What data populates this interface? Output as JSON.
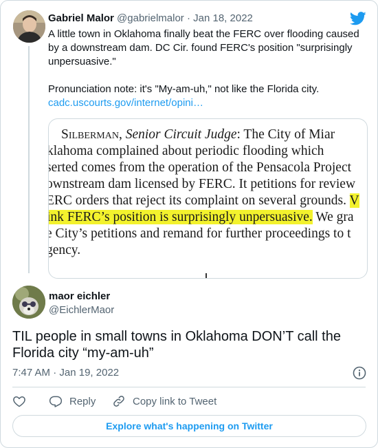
{
  "quoted_tweet": {
    "name": "Gabriel Malor",
    "handle": "@gabrielmalor",
    "separator": "·",
    "date": "Jan 18, 2022",
    "text_line1": "A little town in Oklahoma finally beat the FERC over flooding caused by a downstream dam. DC Cir. found FERC's position \"surprisingly unpersuasive.\"",
    "text_line2": "Pronunciation note: it's \"My-am-uh,\" not like the Florida city.",
    "link": "cadc.uscourts.gov/internet/opini…",
    "image_text": {
      "l1_smallcaps": "Silberman,",
      "l1_italic": "Senior Circuit Judge",
      "l1_rest": ": The City of Miar",
      "l2": "klahoma complained about periodic flooding which",
      "l3": "serted comes from the operation of the Pensacola Project",
      "l4": "ownstream dam licensed by FERC.  It petitions for review",
      "l5_a": "ERC orders that reject its complaint on several grounds.  ",
      "l5_b": "V",
      "l6_hl": "ink FERC’s position is surprisingly unpersuasive.",
      "l6_rest": "  We gra",
      "l7": "e City’s petitions and remand for further proceedings to t",
      "l8": "gency."
    }
  },
  "tweet": {
    "name": "maor eichler",
    "handle": "@EichlerMaor",
    "text": "TIL people in small towns in Oklahoma DON’T call the Florida city “my-am-uh”",
    "time": "7:47 AM",
    "separator": "·",
    "date": "Jan 19, 2022"
  },
  "actions": {
    "like_icon": "heart-icon",
    "reply_label": "Reply",
    "copy_label": "Copy link to Tweet"
  },
  "explore_label": "Explore what's happening on Twitter",
  "colors": {
    "accent": "#1d9bf0",
    "muted": "#536471",
    "border": "#cfd9de",
    "highlight": "#f3f22d"
  }
}
